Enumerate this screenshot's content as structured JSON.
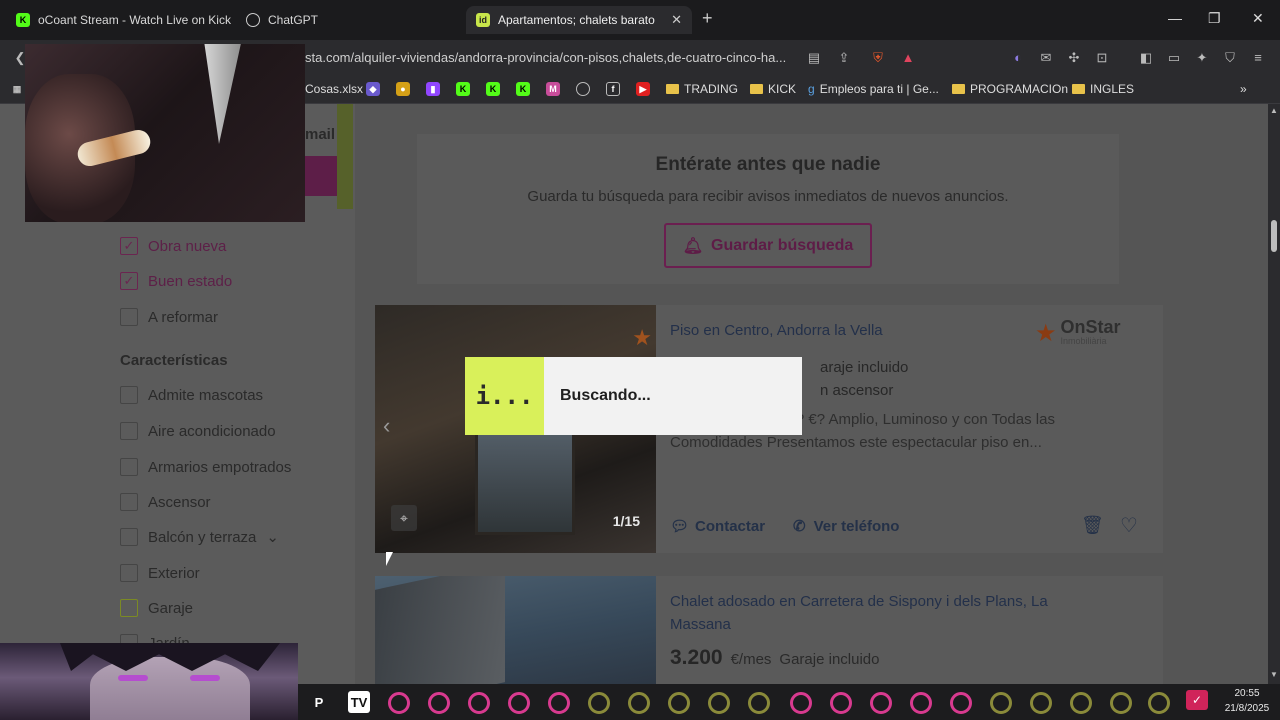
{
  "browser": {
    "tabs": [
      {
        "title": "oCoant Stream - Watch Live on Kick",
        "icon": "kick-icon"
      },
      {
        "title": "ChatGPT",
        "icon": "chatgpt-icon"
      },
      {
        "title": "Apartamentos; chalets baratos e",
        "icon": "idealista-icon"
      }
    ],
    "url": "sta.com/alquiler-viviendas/andorra-provincia/con-pisos,chalets,de-cuatro-cinco-ha..."
  },
  "bookmarks": [
    {
      "label": "Cosas.xlsx",
      "type": "file"
    },
    {
      "label": "TRADING",
      "type": "folder"
    },
    {
      "label": "KICK",
      "type": "folder"
    },
    {
      "label": "Empleos para ti | Ge...",
      "type": "link"
    },
    {
      "label": "PROGRAMACIOn",
      "type": "folder"
    },
    {
      "label": "INGLES",
      "type": "folder"
    }
  ],
  "sidebar": {
    "email_fragment": "mail",
    "filters_state": [
      {
        "label": "Obra nueva",
        "checked": true
      },
      {
        "label": "Buen estado",
        "checked": true
      },
      {
        "label": "A reformar",
        "checked": false
      }
    ],
    "features_title": "Características",
    "features": [
      {
        "label": "Admite mascotas",
        "checked": false
      },
      {
        "label": "Aire acondicionado",
        "checked": false
      },
      {
        "label": "Armarios empotrados",
        "checked": false
      },
      {
        "label": "Ascensor",
        "checked": false
      },
      {
        "label": "Balcón y terraza",
        "checked": false,
        "expandable": true
      },
      {
        "label": "Exterior",
        "checked": false
      },
      {
        "label": "Garaje",
        "checked": false
      },
      {
        "label": "Jardín",
        "checked": false
      }
    ]
  },
  "alert": {
    "title": "Entérate antes que nadie",
    "subtitle": "Guarda tu búsqueda para recibir avisos inmediatos de nuevos anuncios.",
    "button": "Guardar búsqueda"
  },
  "listings": [
    {
      "title": "Piso en Centro, Andorra la Vella",
      "feature_line_1": "araje incluido",
      "feature_line_2": "n ascensor",
      "description": "lquiler en el Centro? €? Amplio, Luminoso y con Todas las Comodidades Presentamos este espectacular piso en...",
      "photo_counter": "1/15",
      "agency": "OnStar",
      "agency_sub": "Inmobiliària",
      "contact_label": "Contactar",
      "phone_label": "Ver teléfono"
    },
    {
      "title": "Chalet adosado en Carretera de Sispony i dels Plans, La Massana",
      "price": "3.200",
      "price_unit": "€/mes",
      "feature": "Garaje incluido"
    }
  ],
  "loading": {
    "logo_text": "i...",
    "text": "Buscando..."
  },
  "taskbar": {
    "time": "20:55",
    "date": "21/8/2025"
  }
}
